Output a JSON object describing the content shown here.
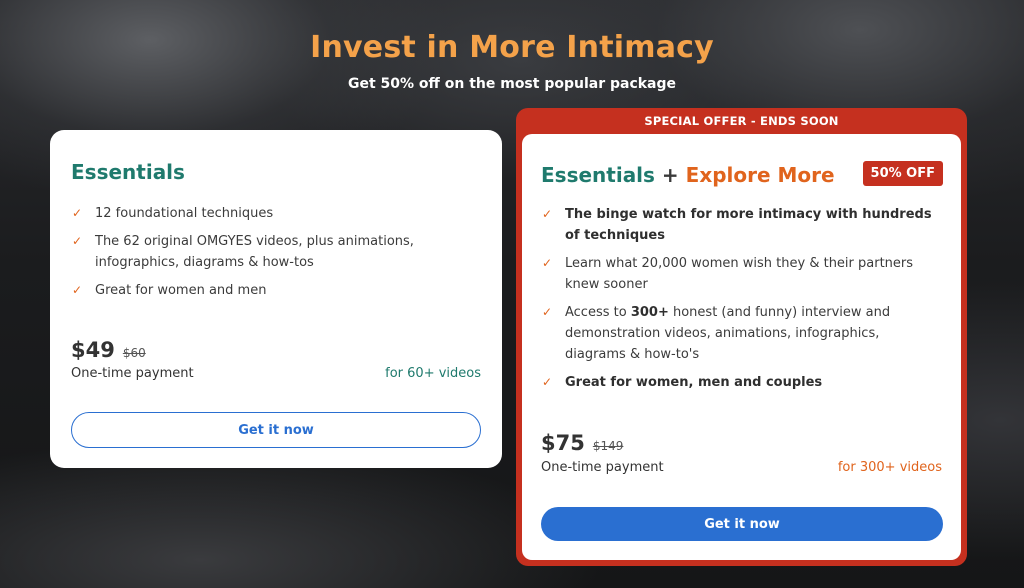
{
  "hero": {
    "title": "Invest in More Intimacy",
    "subtitle": "Get 50% off on the most popular package"
  },
  "essentials": {
    "title": "Essentials",
    "features": [
      "12 foundational techniques",
      "The 62 original OMGYES videos, plus animations, infographics, diagrams & how-tos",
      "Great for women and men"
    ],
    "price": "$49",
    "old_price": "$60",
    "payment": "One-time payment",
    "videos": "for 60+ videos",
    "button": "Get it now"
  },
  "offer": {
    "banner": "SPECIAL OFFER - ENDS SOON",
    "title_part1": "Essentials",
    "title_plus": "+",
    "title_part2": "Explore More",
    "badge": "50% OFF",
    "features": [
      "The binge watch for more intimacy with hundreds of techniques",
      "Learn what 20,000 women wish they & their partners knew sooner",
      "Access to 300+ honest (and funny) interview and demonstration videos, animations, infographics, diagrams & how-to's",
      "Great for women, men and couples"
    ],
    "feature3_prefix": "Access to ",
    "feature3_bold": "300+",
    "feature3_suffix": " honest (and funny) interview and demonstration videos, animations, infographics, diagrams & how-to's",
    "price": "$75",
    "old_price": "$149",
    "payment": "One-time payment",
    "videos": "for 300+ videos",
    "button": "Get it now"
  },
  "colors": {
    "accent_orange": "#f4a24a",
    "teal": "#1f7a6d",
    "orange": "#e0641d",
    "red": "#c5301f",
    "blue": "#2a6fd1"
  },
  "icons": {
    "check": "check-icon"
  }
}
